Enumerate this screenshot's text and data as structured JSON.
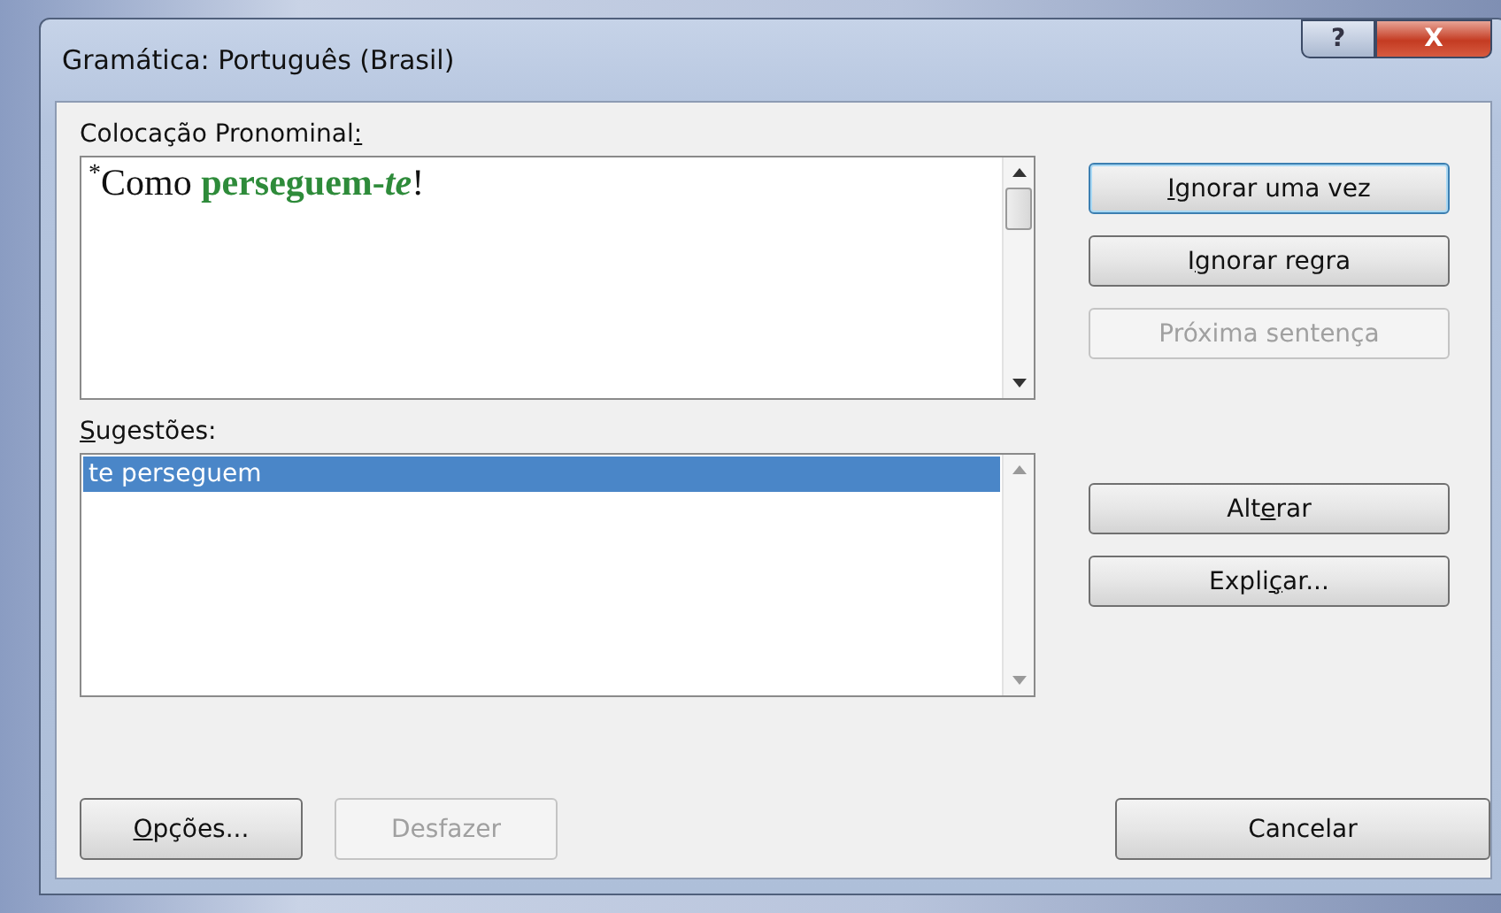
{
  "window": {
    "title": "Gramática: Português (Brasil)",
    "controls": [
      {
        "kind": "help",
        "label": "?"
      },
      {
        "kind": "close",
        "label": "X"
      }
    ]
  },
  "error_label": {
    "pre": "Colocação Pronominal",
    "key": ":"
  },
  "sentence": {
    "marker": "*",
    "segments": [
      {
        "text": "Como ",
        "flagged": false
      },
      {
        "text": "perseguem-*te*",
        "flagged": true
      },
      {
        "text": "!",
        "flagged": false
      }
    ]
  },
  "suggestions_label": {
    "key": "S",
    "post": "ugestões:"
  },
  "suggestions": [
    {
      "text": "te perseguem",
      "selected": true
    }
  ],
  "top_buttons": [
    {
      "key": "I",
      "post": "gnorar uma vez",
      "disabled": false,
      "focused": true
    },
    {
      "pre": "I",
      "key": "g",
      "post": "norar regra",
      "disabled": false,
      "focused": false
    },
    {
      "pre": "Próxima sentença",
      "disabled": true,
      "focused": false
    }
  ],
  "middle_buttons": [
    {
      "pre": "Alt",
      "key": "e",
      "post": "rar",
      "disabled": false,
      "focused": false
    },
    {
      "pre": "Expli",
      "key": "ç",
      "post": "ar...",
      "disabled": false,
      "focused": false
    }
  ],
  "bottom_left_buttons": [
    {
      "key": "O",
      "post": "pções...",
      "disabled": false,
      "focused": false
    },
    {
      "pre": "Desfazer",
      "disabled": true,
      "focused": false
    }
  ],
  "cancel_button": {
    "pre": "Cancelar",
    "disabled": false,
    "focused": false
  }
}
